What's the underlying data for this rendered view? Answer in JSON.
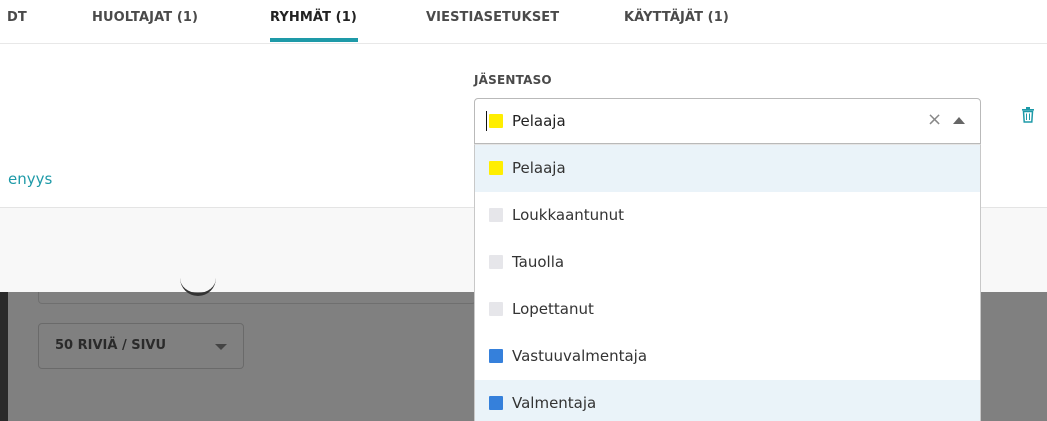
{
  "tabs": [
    {
      "label": "DT"
    },
    {
      "label": "HUOLTAJAT (1)"
    },
    {
      "label": "RYHMÄT (1)",
      "active": true
    },
    {
      "label": "VIESTIASETUKSET"
    },
    {
      "label": "KÄYTTÄJÄT (1)"
    }
  ],
  "member_level": {
    "label": "JÄSENTASO",
    "selected": "Pelaaja",
    "selected_color": "#ffee00",
    "clear_glyph": "×"
  },
  "link_fragment": "enyys",
  "per_page": {
    "label": "50 RIVIÄ / SIVU"
  },
  "options": [
    {
      "label": "Pelaaja",
      "color": "#ffee00",
      "highlight": true
    },
    {
      "label": "Loukkaantunut",
      "color": "#e6e6ea"
    },
    {
      "label": "Tauolla",
      "color": "#e6e6ea"
    },
    {
      "label": "Lopettanut",
      "color": "#e6e6ea"
    },
    {
      "label": "Vastuuvalmentaja",
      "color": "#3580db"
    },
    {
      "label": "Valmentaja",
      "color": "#3580db",
      "highlight": true
    }
  ],
  "icons": {
    "delete": "trash-icon",
    "clear": "close-icon",
    "collapse": "chevron-up-icon",
    "expand": "chevron-down-icon"
  }
}
